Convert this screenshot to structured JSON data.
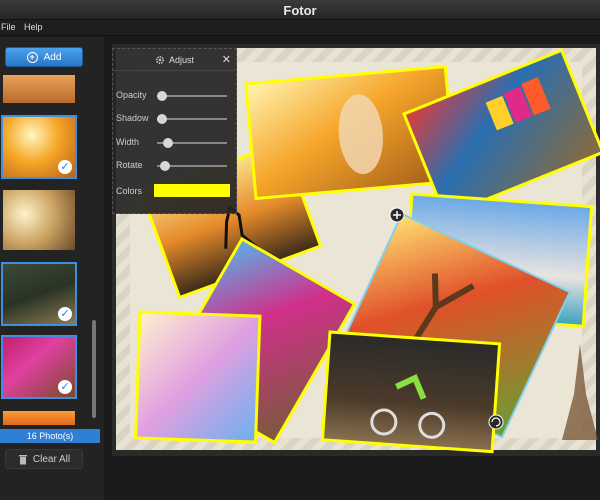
{
  "window": {
    "title": "Fotor"
  },
  "menu": {
    "file": "File",
    "help": "Help"
  },
  "sidebar": {
    "add_label": "Add",
    "photo_count": "16 Photo(s)",
    "clear_label": "Clear All"
  },
  "adjust_panel": {
    "title": "Adjust",
    "labels": {
      "opacity": "Opacity",
      "shadow": "Shadow",
      "width": "Width",
      "rotate": "Rotate",
      "colors": "Colors"
    },
    "levels": {
      "opacity": 0.0,
      "shadow": 0.0,
      "width": 0.1,
      "rotate": 0.05
    },
    "color": "#ffff00"
  },
  "collage_border_color": "#ffff00",
  "accent_color": "#2f7fd6"
}
